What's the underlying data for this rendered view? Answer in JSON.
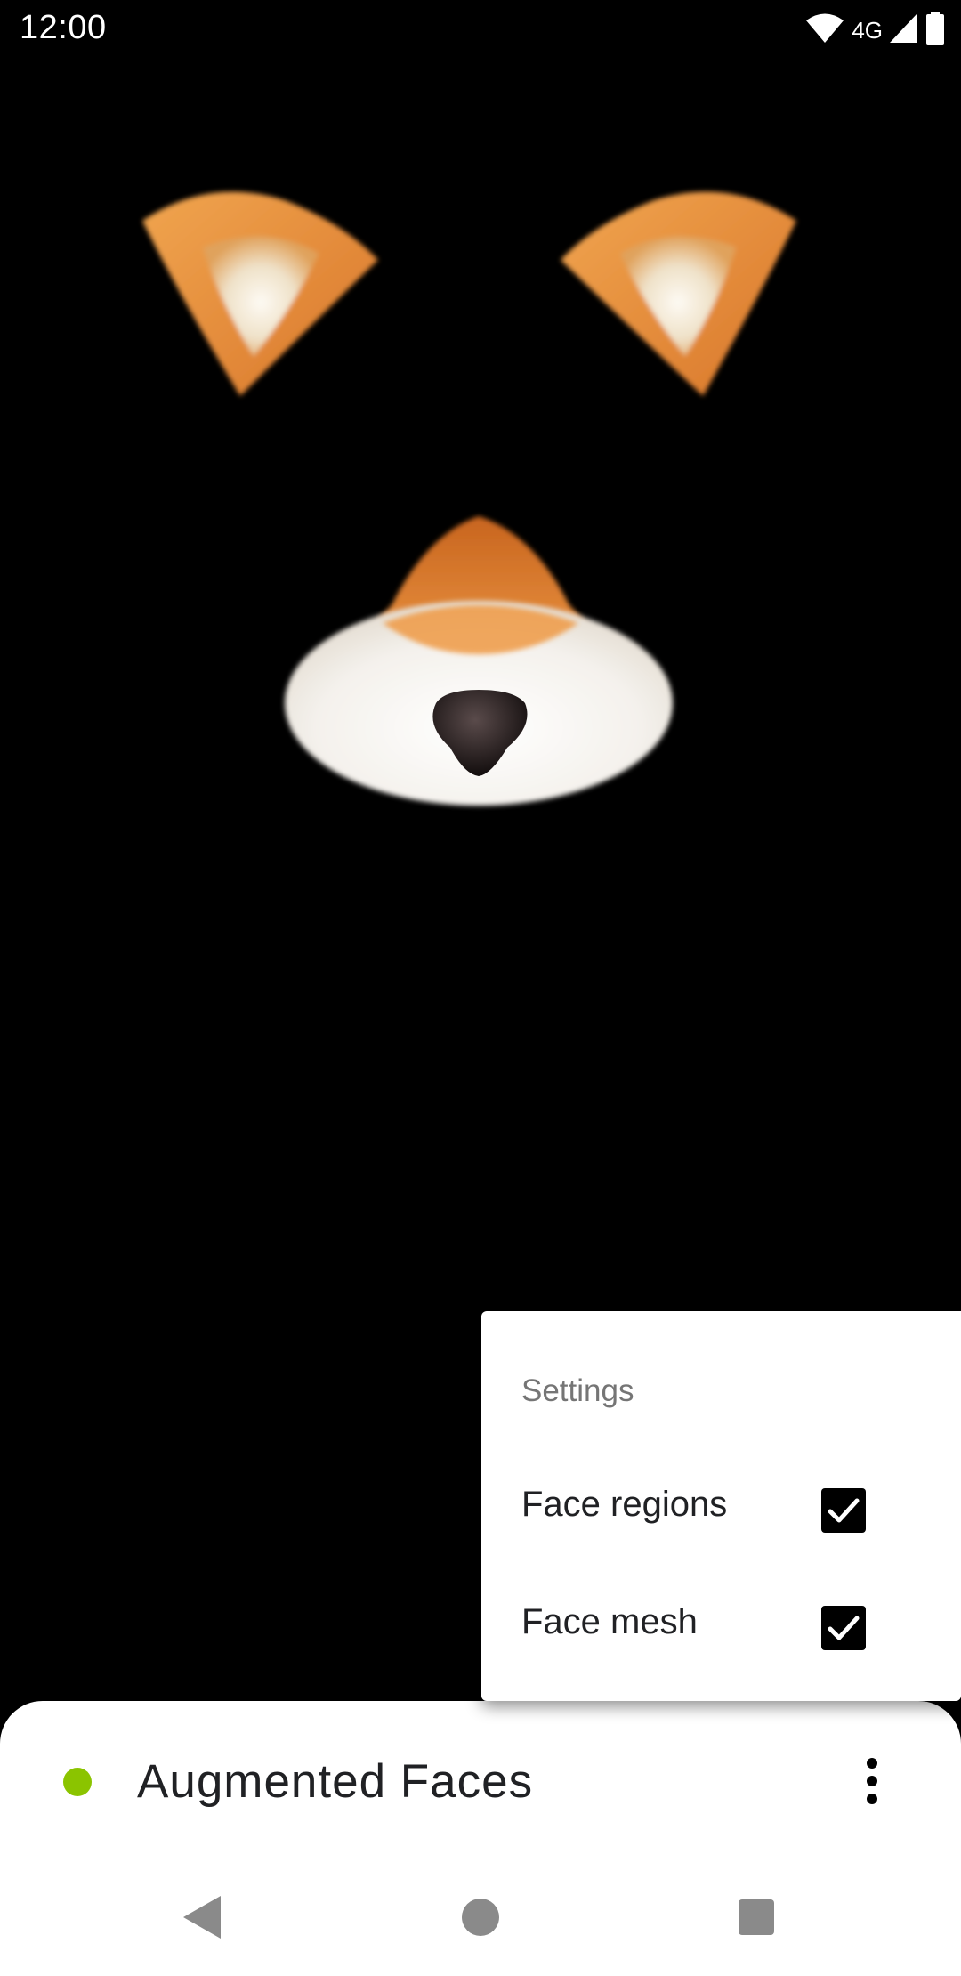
{
  "status_bar": {
    "time": "12:00",
    "network": "4G",
    "icons": [
      "wifi-icon",
      "cell-signal-icon",
      "battery-icon"
    ]
  },
  "settings_menu": {
    "title": "Settings",
    "items": [
      {
        "label": "Face regions",
        "checked": true
      },
      {
        "label": "Face mesh",
        "checked": true
      }
    ]
  },
  "bottom_sheet": {
    "title": "Augmented Faces",
    "status_dot_color": "#8bc400",
    "overflow_icon": "more-vert-icon"
  },
  "nav_bar": {
    "buttons": [
      "back-icon",
      "home-icon",
      "recents-icon"
    ]
  },
  "colors": {
    "fur_orange": "#e8892f",
    "fur_white": "#f4f1ec",
    "nose": "#1a1414"
  }
}
